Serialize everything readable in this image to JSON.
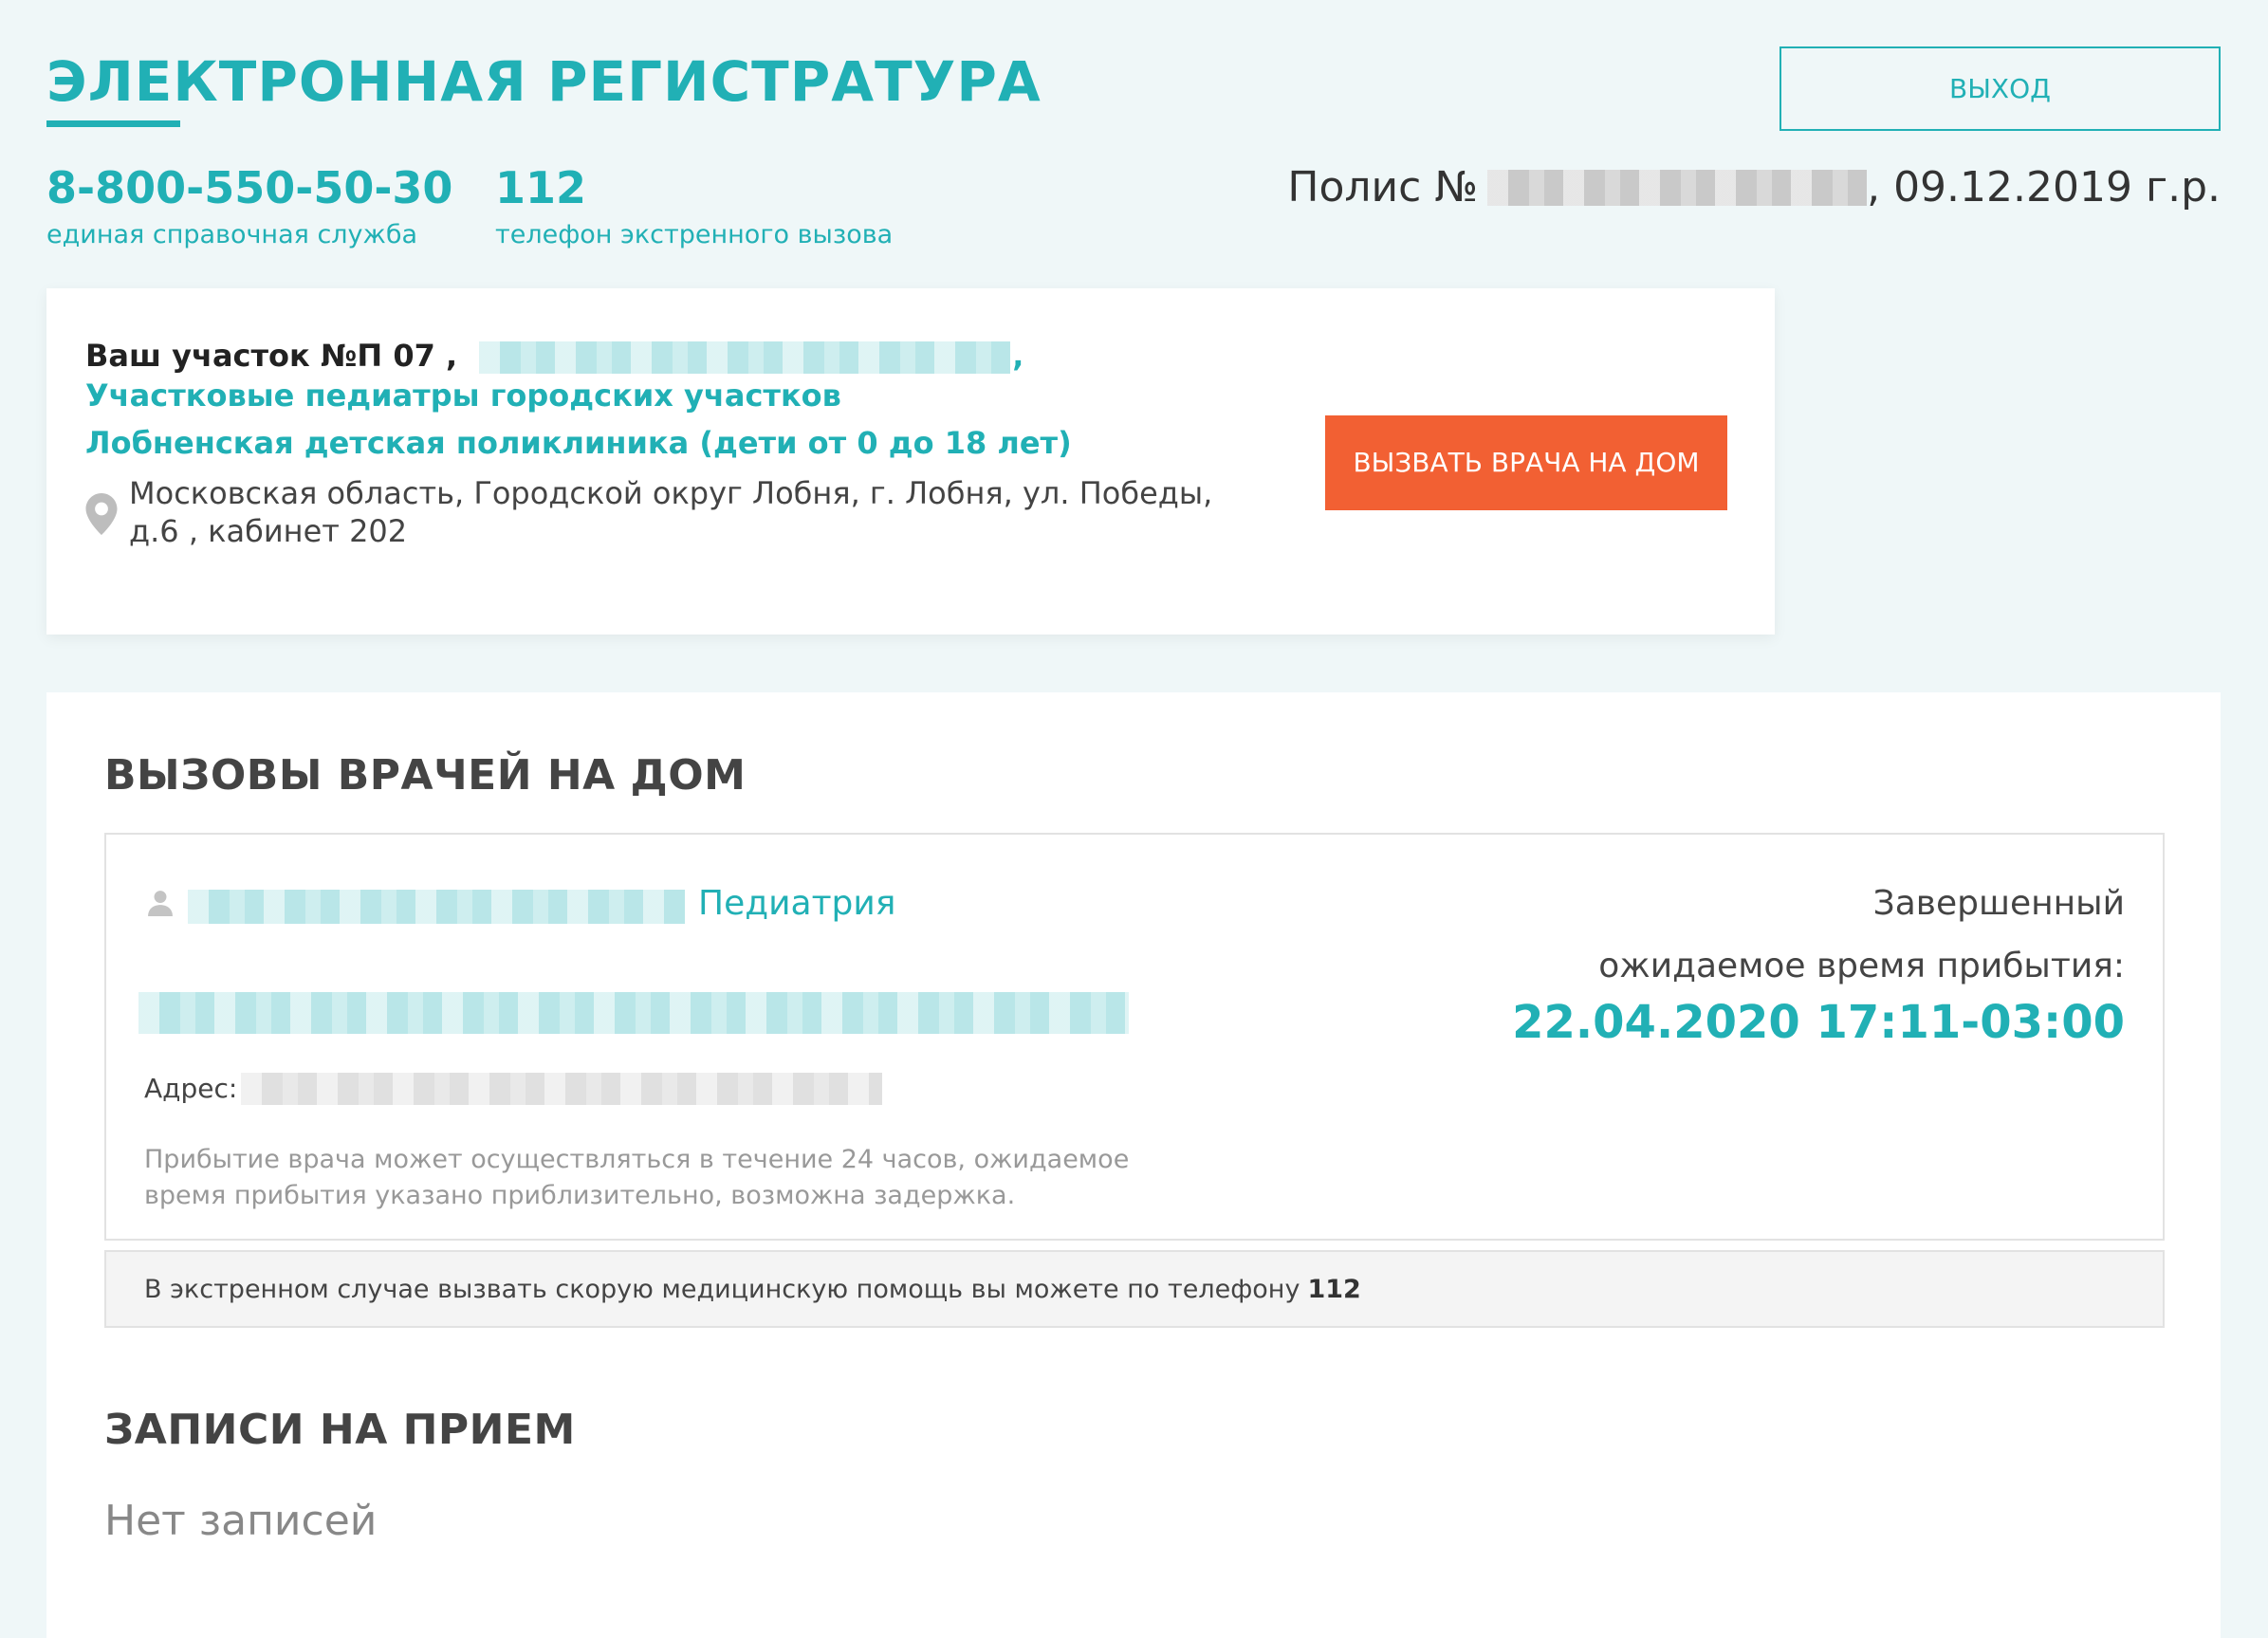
{
  "header": {
    "brand": "ЭЛЕКТРОННАЯ РЕГИСТРАТУРА",
    "logout_label": "ВЫХОД",
    "phones": [
      {
        "number": "8-800-550-50-30",
        "caption": "единая справочная служба"
      },
      {
        "number": "112",
        "caption": "телефон экстренного вызова"
      }
    ],
    "polis_prefix": "Полис №",
    "polis_suffix": ", 09.12.2019 г.р."
  },
  "area": {
    "title_prefix": "Ваш участок №П 07 ,",
    "title_teal": ", Участковые педиатры городских участков",
    "clinic": "Лобненская детская поликлиника (дети от 0 до 18 лет)",
    "address": "Московская область, Городской округ Лобня, г. Лобня, ул. Победы, д.6 , кабинет 202",
    "call_doctor_label": "ВЫЗВАТЬ ВРАЧА НА ДОМ"
  },
  "home_visits": {
    "title": "ВЫЗОВЫ ВРАЧЕЙ НА ДОМ",
    "items": [
      {
        "specialty": "Педиатрия",
        "status": "Завершенный",
        "eta_label": "ожидаемое время прибытия:",
        "eta_value": "22.04.2020 17:11-03:00",
        "address_label": "Адрес:",
        "note": "Прибытие врача может осуществляться в течение 24 часов, ожидаемое время прибытия указано приблизительно, возможна задержка."
      }
    ],
    "emergency_text": "В экстренном случае вызвать скорую медицинскую помощь вы можете по телефону",
    "emergency_number": "112"
  },
  "appointments": {
    "title": "ЗАПИСИ НА ПРИЕМ",
    "empty_text": "Нет записей"
  },
  "colors": {
    "accent": "#21b0b5",
    "cta": "#f26033",
    "background": "#eff7f8"
  }
}
